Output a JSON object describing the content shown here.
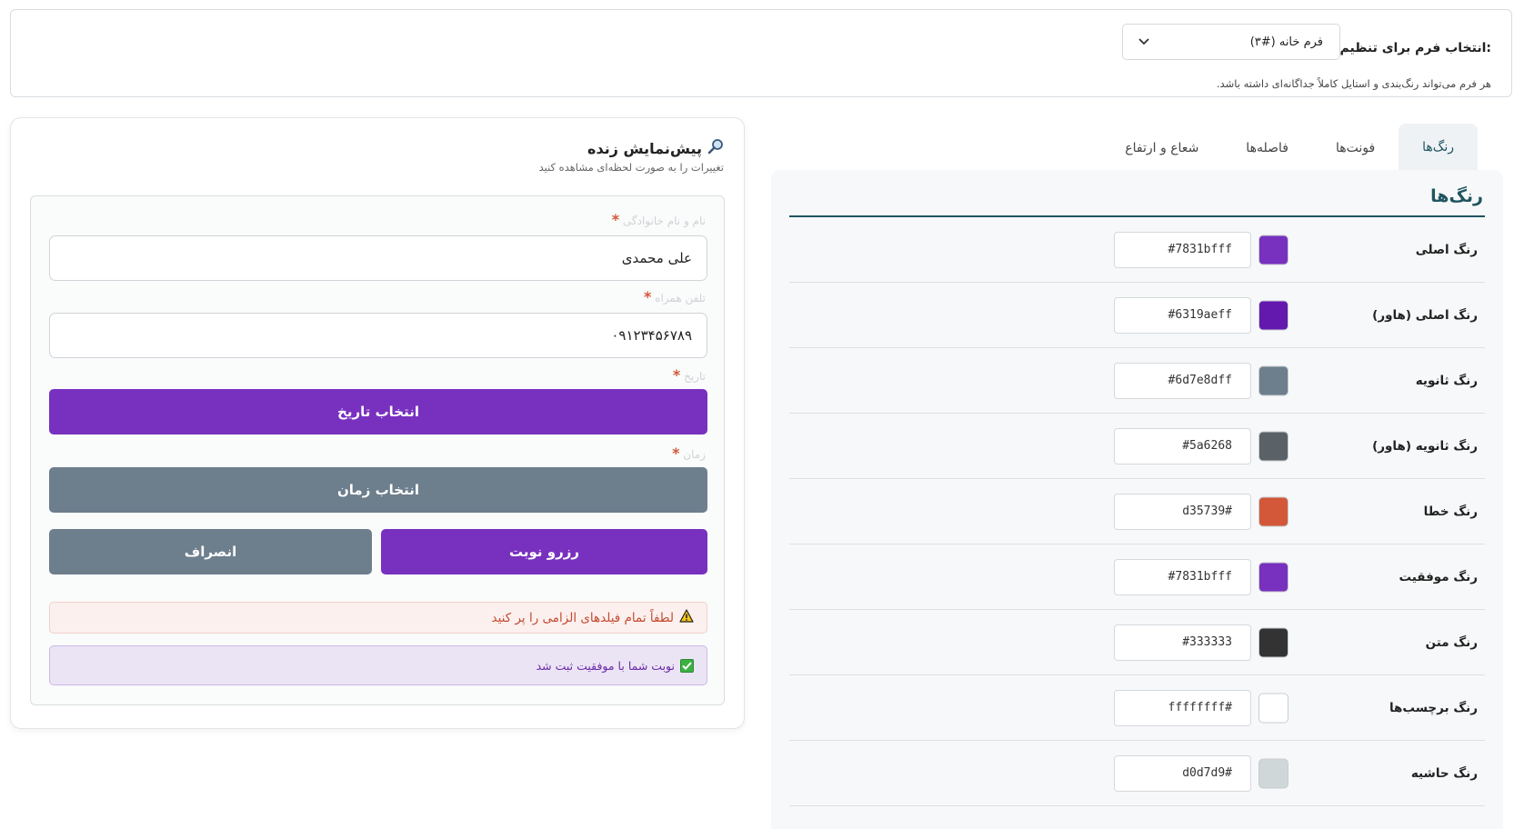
{
  "form_selector": {
    "label": "انتخاب فرم برای تنظیم استایل:",
    "selected": "فرم خانه (#۳)",
    "hint": "هر فرم می‌تواند رنگ‌بندی و استایل کاملاً جداگانه‌ای داشته باشد."
  },
  "tabs": [
    {
      "label": "رنگ‌ها",
      "active": true
    },
    {
      "label": "فونت‌ها",
      "active": false
    },
    {
      "label": "فاصله‌ها",
      "active": false
    },
    {
      "label": "شعاع و ارتفاع",
      "active": false
    }
  ],
  "colors_panel": {
    "title": "رنگ‌ها",
    "rows": [
      {
        "label": "رنگ اصلی",
        "value": "#7831bfff",
        "swatch": "#7831bf"
      },
      {
        "label": "رنگ اصلی (هاور)",
        "value": "#6319aeff",
        "swatch": "#6319ae"
      },
      {
        "label": "رنگ ثانویه",
        "value": "#6d7e8dff",
        "swatch": "#6d7e8d"
      },
      {
        "label": "رنگ ثانویه (هاور)",
        "value": "#5a6268",
        "swatch": "#5a6268"
      },
      {
        "label": "رنگ خطا",
        "value": "d35739#",
        "swatch": "#d35739"
      },
      {
        "label": "رنگ موفقیت",
        "value": "#7831bfff",
        "swatch": "#7831bf"
      },
      {
        "label": "رنگ متن",
        "value": "#333333",
        "swatch": "#333333"
      },
      {
        "label": "رنگ برچسب‌ها",
        "value": "ffffffff#",
        "swatch": "#ffffff"
      },
      {
        "label": "رنگ حاشیه",
        "value": "d0d7d9#",
        "swatch": "#d0d7d9"
      }
    ]
  },
  "preview": {
    "title": "پیش‌نمایش زنده",
    "title_icon": "magnifier-icon",
    "subtitle": "تغییرات را به صورت لحظه‌ای مشاهده کنید",
    "fields": [
      {
        "label": "نام و نام خانوادگی",
        "required": "*",
        "value": "علی محمدی"
      },
      {
        "label": "تلفن همراه",
        "required": "*",
        "value": "۰۹۱۲۳۴۵۶۷۸۹"
      },
      {
        "label": "تاریخ",
        "required": "*"
      },
      {
        "label": "زمان",
        "required": "*"
      }
    ],
    "date_button": "انتخاب تاریخ",
    "time_button": "انتخاب زمان",
    "submit_button": "رزرو نوبت",
    "cancel_button": "انصراف",
    "error_message": "لطفاً تمام فیلدهای الزامی را پر کنید",
    "success_message": "نوبت شما با موفقیت ثبت شد"
  }
}
